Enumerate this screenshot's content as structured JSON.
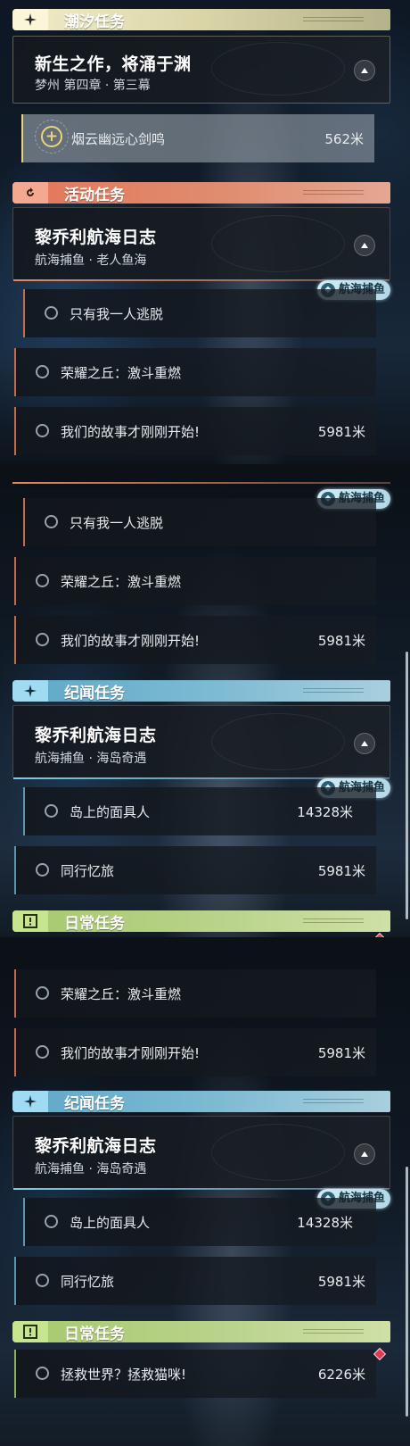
{
  "colors": {
    "tide": "#dad5a8",
    "event": "#e08c6e",
    "chronicle": "#7ebbd3",
    "daily": "#b9d38a",
    "tag": "#c5e3ef",
    "focus_ring": "#ecd478",
    "marker": "#e23a4c"
  },
  "icons": {
    "tide": "sparkle-icon",
    "event": "refresh-arrow-icon",
    "chronicle": "sparkle-icon",
    "daily": "exclamation-box-icon",
    "collapse": "triangle-up-icon",
    "track": "plus-circle-icon",
    "tag": "fish-icon",
    "marker": "diamond-marker-icon"
  },
  "frame1": {
    "tide_header": "潮汐任务",
    "tide_card": {
      "title": "新生之作，将涌于渊",
      "subtitle": "梦州 第四章 · 第三幕"
    },
    "tracked_task": {
      "label": "烟云幽远心剑鸣",
      "distance": "562米"
    },
    "event_header": "活动任务",
    "event_card": {
      "title": "黎乔利航海日志",
      "subtitle": "航海捕鱼 · 老人鱼海"
    },
    "tag": "航海捕鱼",
    "tasks": [
      {
        "label": "只有我一人逃脱",
        "distance": ""
      },
      {
        "label": "荣耀之丘：激斗重燃",
        "distance": ""
      },
      {
        "label": "我们的故事才刚刚开始!",
        "distance": "5981米"
      }
    ]
  },
  "frame2": {
    "tag1": "航海捕鱼",
    "tasks": [
      {
        "label": "只有我一人逃脱",
        "distance": ""
      },
      {
        "label": "荣耀之丘：激斗重燃",
        "distance": ""
      },
      {
        "label": "我们的故事才刚刚开始!",
        "distance": "5981米"
      }
    ],
    "chron_header": "纪闻任务",
    "chron_card": {
      "title": "黎乔利航海日志",
      "subtitle": "航海捕鱼 · 海岛奇遇"
    },
    "tag2": "航海捕鱼",
    "chron_tasks": [
      {
        "label": "岛上的面具人",
        "distance": "14328米"
      },
      {
        "label": "同行忆旅",
        "distance": "5981米"
      }
    ],
    "daily_header": "日常任务"
  },
  "frame3": {
    "tasks": [
      {
        "label": "荣耀之丘：激斗重燃",
        "distance": ""
      },
      {
        "label": "我们的故事才刚刚开始!",
        "distance": "5981米"
      }
    ],
    "chron_header": "纪闻任务",
    "chron_card": {
      "title": "黎乔利航海日志",
      "subtitle": "航海捕鱼 · 海岛奇遇"
    },
    "tag": "航海捕鱼",
    "chron_tasks": [
      {
        "label": "岛上的面具人",
        "distance": "14328米"
      },
      {
        "label": "同行忆旅",
        "distance": "5981米"
      }
    ],
    "daily_header": "日常任务",
    "daily_tasks": [
      {
        "label": "拯救世界？拯救猫咪!",
        "distance": "6226米"
      }
    ]
  }
}
